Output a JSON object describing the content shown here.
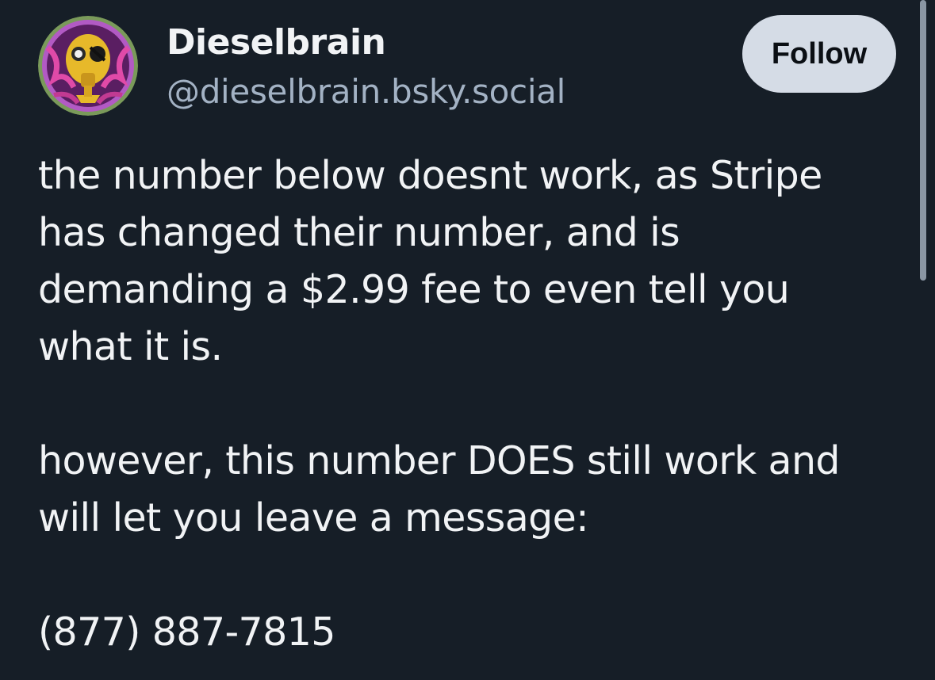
{
  "author": {
    "display_name": "Dieselbrain",
    "handle": "@dieselbrain.bsky.social",
    "avatar_icon": "gas-mask-avatar"
  },
  "follow_button": {
    "label": "Follow"
  },
  "post": {
    "lines": [
      "the number below doesnt work, as Stripe",
      "has changed their number, and is",
      "demanding a $2.99 fee to even tell you",
      "what it is.",
      "",
      "however, this number DOES still work and",
      "will let you leave a message:",
      "",
      "(877) 887-7815"
    ]
  },
  "colors": {
    "background": "#161e27",
    "text": "#f1f3f5",
    "handle": "#a3b2c4",
    "follow_button_bg": "#d5dce6"
  }
}
